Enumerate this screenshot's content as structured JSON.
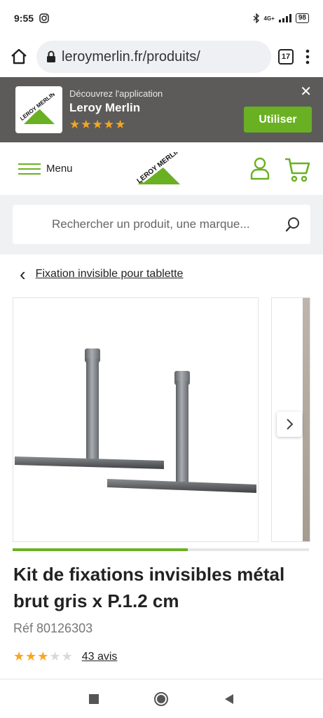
{
  "status_bar": {
    "time": "9:55",
    "network": "4G+",
    "battery": "98"
  },
  "browser": {
    "url": "leroymerlin.fr/produits/",
    "tab_count": "17"
  },
  "app_banner": {
    "discover_text": "Découvrez l'application",
    "app_name": "Leroy Merlin",
    "use_button": "Utiliser",
    "stars": "★★★★★",
    "logo_text": "LEROY MERLIN",
    "close_symbol": "✕"
  },
  "header": {
    "menu_label": "Menu",
    "logo_text": "LEROY MERLIN"
  },
  "search": {
    "placeholder": "Rechercher un produit, une marque..."
  },
  "breadcrumb": {
    "back_symbol": "‹",
    "label": "Fixation invisible pour tablette"
  },
  "gallery": {
    "progress_fraction": 0.59
  },
  "product": {
    "title": "Kit de fixations invisibles métal brut gris x P.1.2 cm",
    "reference": "Réf 80126303",
    "rating_value": 3,
    "rating_max": 5,
    "reviews": "43 avis"
  },
  "colors": {
    "brand_green": "#6ab023",
    "banner_bg": "#5c5b5a",
    "star": "#f6a623"
  }
}
